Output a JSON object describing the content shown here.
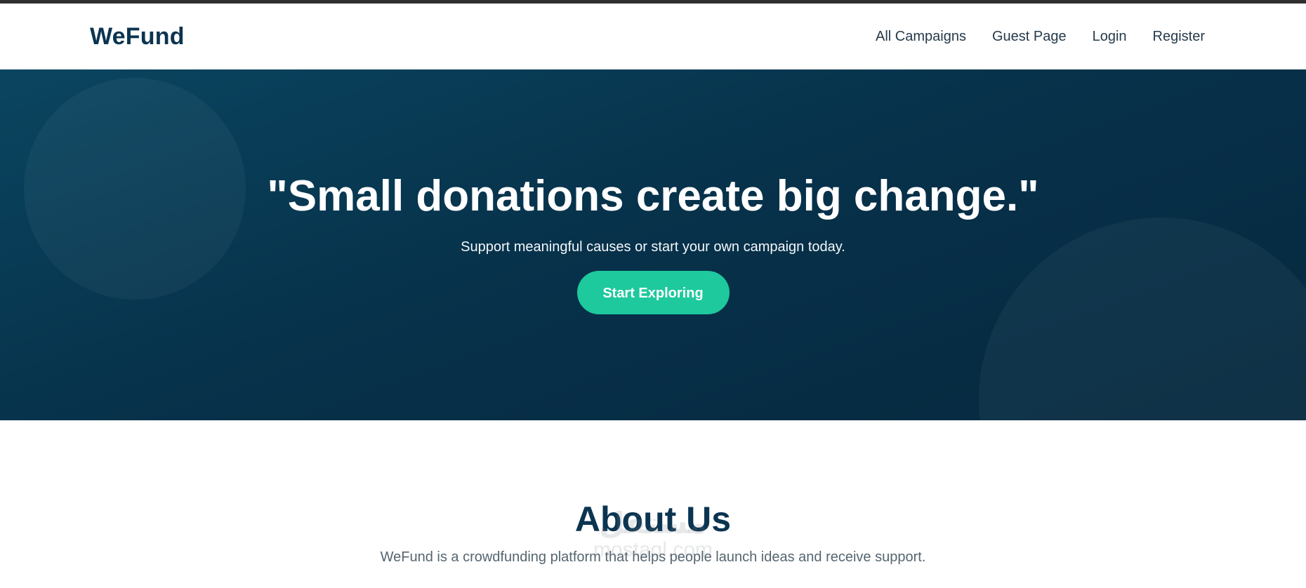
{
  "topbar": {
    "color": "#2f2f2f"
  },
  "nav": {
    "brand": "WeFund",
    "links": [
      "All Campaigns",
      "Guest Page",
      "Login",
      "Register"
    ]
  },
  "hero": {
    "title": "\"Small donations create big change.\"",
    "subtitle": "Support meaningful causes or start your own campaign today.",
    "cta_label": "Start Exploring"
  },
  "about": {
    "title": "About Us",
    "text": "WeFund is a crowdfunding platform that helps people launch ideas and receive support."
  },
  "watermark": {
    "main": "مستقل",
    "sub": "mostaql.com"
  },
  "colors": {
    "brand": "#0b3450",
    "hero_bg": "#07324b",
    "accent": "#1dc99d"
  }
}
